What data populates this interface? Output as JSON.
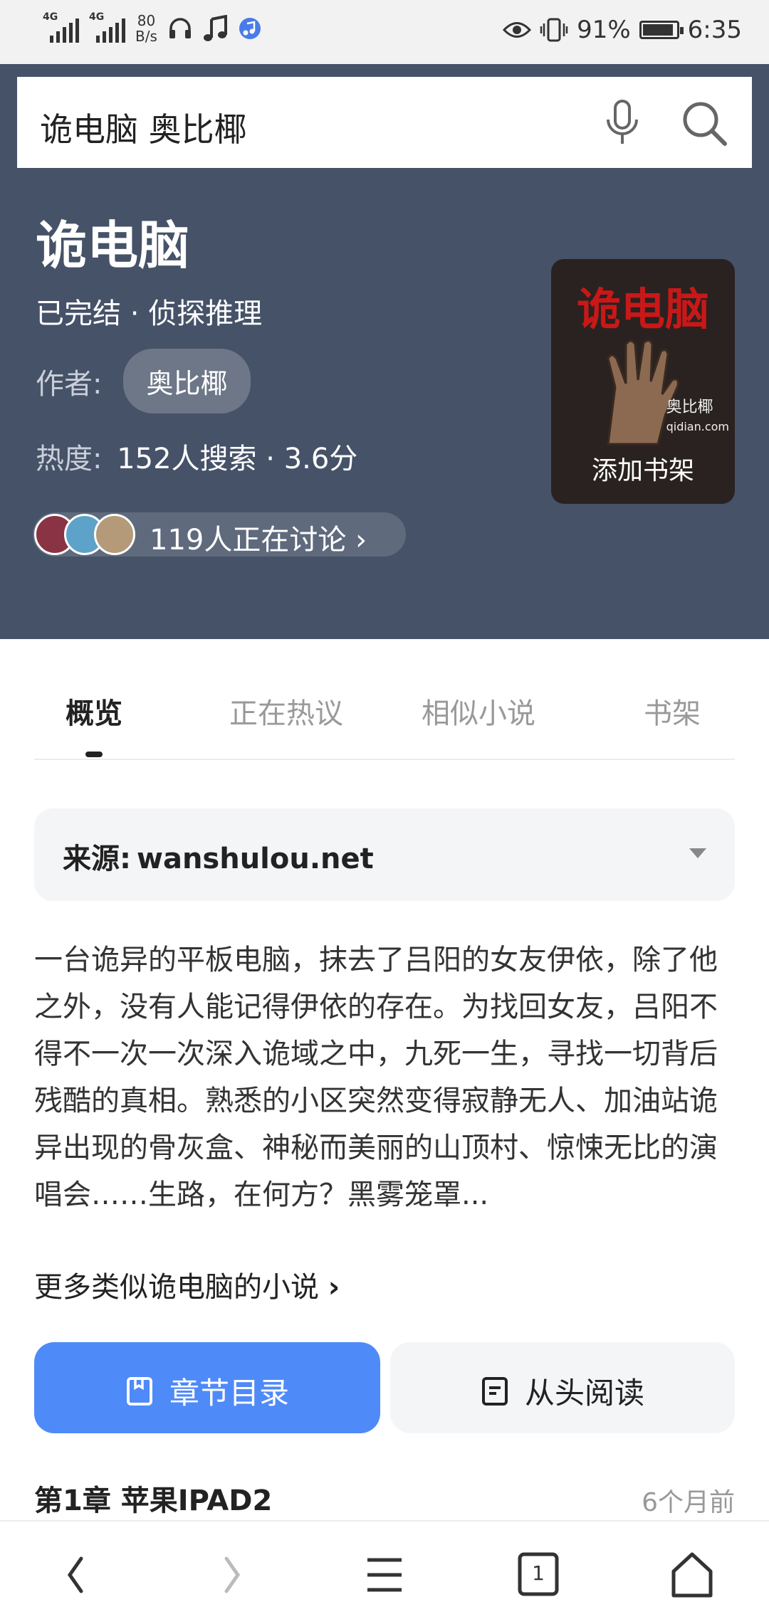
{
  "status_bar": {
    "signal1": "4G",
    "signal2": "4G",
    "speed_value": "80",
    "speed_unit": "B/s",
    "battery": "91%",
    "battery_level": 0.91,
    "time": "6:35"
  },
  "search": {
    "query": "诡电脑 奥比椰"
  },
  "book": {
    "title": "诡电脑",
    "status": "已完结 · 侦探推理",
    "author_label": "作者:",
    "author": "奥比椰",
    "heat_label": "热度:",
    "heat_value": "152人搜索 · 3.6分",
    "discussion": "119人正在讨论",
    "cover_title": "诡电脑",
    "cover_author": "奥比椰",
    "cover_site": "qidian.com",
    "add_shelf": "添加书架"
  },
  "tabs": [
    {
      "label": "概览",
      "active": true
    },
    {
      "label": "正在热议",
      "active": false
    },
    {
      "label": "相似小说",
      "active": false
    },
    {
      "label": "书架",
      "active": false
    }
  ],
  "source": {
    "label": "来源:",
    "value": "wanshulou.net"
  },
  "description": "一台诡异的平板电脑，抹去了吕阳的女友伊依，除了他之外，没有人能记得伊依的存在。为找回女友，吕阳不得不一次一次深入诡域之中，九死一生，寻找一切背后残酷的真相。熟悉的小区突然变得寂静无人、加油站诡异出现的骨灰盒、神秘而美丽的山顶村、惊悚无比的演唱会……生路，在何方？黑雾笼罩...",
  "more_link": "更多类似诡电脑的小说",
  "buttons": {
    "toc": "章节目录",
    "read": "从头阅读"
  },
  "latest_chapter": {
    "title": "第1章 苹果IPAD2",
    "time": "6个月前"
  },
  "nav": {
    "tab_count": "1"
  },
  "colors": {
    "header_bg": "#465268",
    "primary": "#4e8af8"
  }
}
